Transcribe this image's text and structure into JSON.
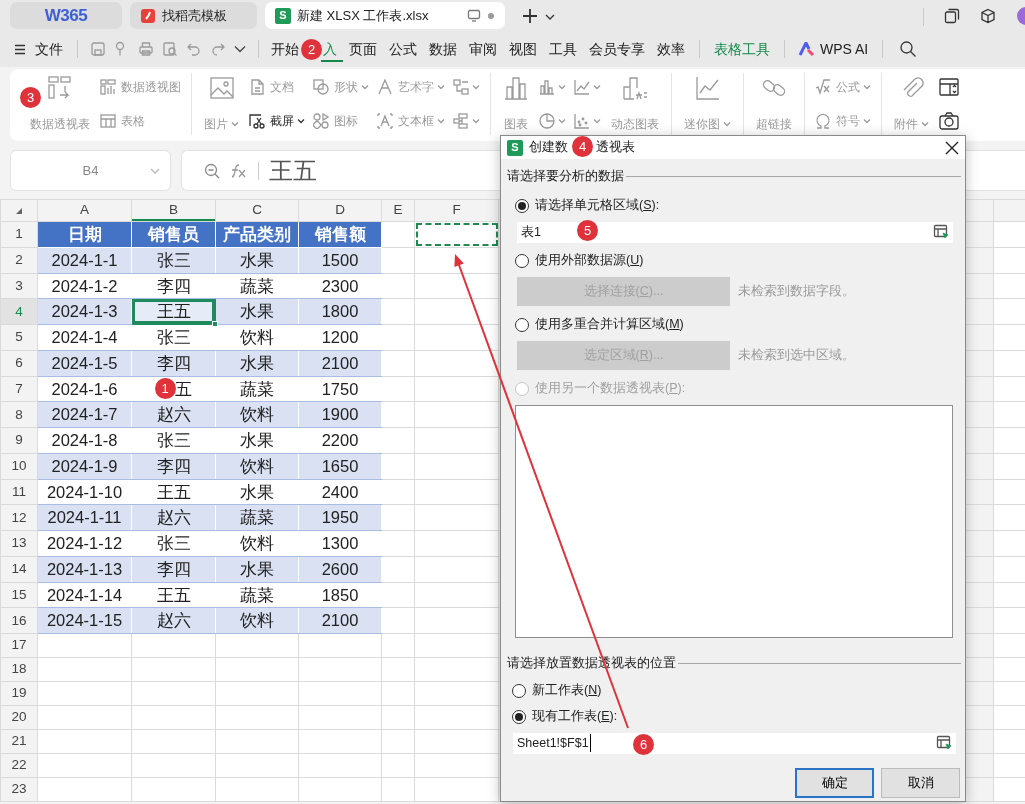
{
  "app_tabs": [
    {
      "kind": "home",
      "label": "W365",
      "selected": false
    },
    {
      "kind": "docer",
      "label": "找稻壳模板",
      "selected": false
    },
    {
      "kind": "sheet",
      "badge": "S",
      "label": "新建 XLSX 工作表.xlsx",
      "selected": true
    }
  ],
  "menu": {
    "file": "文件",
    "tabs": [
      {
        "label": "开始",
        "selected": false
      },
      {
        "label": "入",
        "selected": true,
        "partial": true
      },
      {
        "label": "页面",
        "selected": false
      },
      {
        "label": "公式",
        "selected": false
      },
      {
        "label": "数据",
        "selected": false
      },
      {
        "label": "审阅",
        "selected": false
      },
      {
        "label": "视图",
        "selected": false
      },
      {
        "label": "工具",
        "selected": false
      },
      {
        "label": "会员专享",
        "selected": false
      },
      {
        "label": "效率",
        "selected": false
      }
    ],
    "context_tab": "表格工具",
    "ai": "WPS AI"
  },
  "ribbon": {
    "groups": [
      {
        "columns": [
          {
            "kind": "large",
            "items": [
              {
                "label": "数据透视表",
                "dropdown": false,
                "disabled": true
              }
            ]
          },
          {
            "kind": "stack",
            "items": [
              {
                "label": "数据透视图",
                "dropdown": false,
                "disabled": true
              },
              {
                "label": "表格",
                "dropdown": false,
                "disabled": true
              }
            ]
          }
        ]
      },
      {
        "columns": [
          {
            "kind": "large",
            "items": [
              {
                "label": "图片",
                "dropdown": true,
                "disabled": true
              }
            ]
          },
          {
            "kind": "stack",
            "items": [
              {
                "label": "文档",
                "dropdown": false,
                "disabled": true
              },
              {
                "label": "截屏",
                "dropdown": true,
                "disabled": false
              }
            ]
          },
          {
            "kind": "stack",
            "items": [
              {
                "label": "形状",
                "dropdown": true,
                "disabled": true
              },
              {
                "label": "图标",
                "dropdown": false,
                "disabled": true
              }
            ]
          },
          {
            "kind": "stack",
            "items": [
              {
                "label": "艺术字",
                "dropdown": true,
                "disabled": true
              },
              {
                "label": "文本框",
                "dropdown": true,
                "disabled": true
              }
            ]
          },
          {
            "kind": "stack",
            "items": [
              {
                "dropdown": true,
                "disabled": true
              },
              {
                "dropdown": true,
                "disabled": true
              }
            ]
          }
        ]
      },
      {
        "columns": [
          {
            "kind": "large",
            "items": [
              {
                "label": "图表",
                "dropdown": false,
                "disabled": true
              }
            ]
          },
          {
            "kind": "stack",
            "items": [
              {
                "dropdown": true,
                "disabled": true
              },
              {
                "dropdown": true,
                "disabled": true
              }
            ]
          },
          {
            "kind": "stack",
            "items": [
              {
                "dropdown": true,
                "disabled": true
              },
              {
                "dropdown": true,
                "disabled": true
              }
            ]
          },
          {
            "kind": "large",
            "items": [
              {
                "label": "动态图表",
                "dropdown": false,
                "disabled": true
              }
            ]
          }
        ]
      },
      {
        "columns": [
          {
            "kind": "large",
            "items": [
              {
                "label": "迷你图",
                "dropdown": true,
                "disabled": true
              }
            ]
          }
        ]
      },
      {
        "columns": [
          {
            "kind": "large",
            "items": [
              {
                "label": "超链接",
                "dropdown": false,
                "disabled": true
              }
            ]
          }
        ]
      },
      {
        "columns": [
          {
            "kind": "stack",
            "items": [
              {
                "label": "公式",
                "dropdown": true,
                "disabled": true
              },
              {
                "label": "符号",
                "dropdown": true,
                "disabled": true
              }
            ]
          }
        ]
      },
      {
        "columns": [
          {
            "kind": "large",
            "items": [
              {
                "label": "附件",
                "dropdown": true,
                "disabled": true
              }
            ]
          },
          {
            "kind": "stack",
            "items": [
              {
                "dropdown": false,
                "disabled": false
              },
              {
                "dropdown": false,
                "disabled": false
              }
            ]
          }
        ]
      }
    ]
  },
  "formula_bar": {
    "name_box": "B4",
    "formula": "王五"
  },
  "sheet": {
    "columns": [
      {
        "letter": "A",
        "selected": false
      },
      {
        "letter": "B",
        "selected": true
      },
      {
        "letter": "C",
        "selected": false
      },
      {
        "letter": "D",
        "selected": false
      },
      {
        "letter": "E",
        "selected": false
      },
      {
        "letter": "F",
        "selected": false
      }
    ],
    "row_numbers": [
      {
        "label": "1",
        "selected": false
      },
      {
        "label": "2",
        "selected": false
      },
      {
        "label": "3",
        "selected": false
      },
      {
        "label": "4",
        "selected": true
      },
      {
        "label": "5",
        "selected": false
      },
      {
        "label": "6",
        "selected": false
      },
      {
        "label": "7",
        "selected": false
      },
      {
        "label": "8",
        "selected": false
      },
      {
        "label": "9",
        "selected": false
      },
      {
        "label": "10",
        "selected": false
      },
      {
        "label": "11",
        "selected": false
      },
      {
        "label": "12",
        "selected": false
      },
      {
        "label": "13",
        "selected": false
      },
      {
        "label": "14",
        "selected": false
      },
      {
        "label": "15",
        "selected": false
      },
      {
        "label": "16",
        "selected": false
      },
      {
        "label": "17",
        "selected": false
      },
      {
        "label": "18",
        "selected": false
      },
      {
        "label": "19",
        "selected": false
      },
      {
        "label": "20",
        "selected": false
      },
      {
        "label": "21",
        "selected": false
      },
      {
        "label": "22",
        "selected": false
      },
      {
        "label": "23",
        "selected": false
      }
    ],
    "table_header": [
      "日期",
      "销售员",
      "产品类别",
      "销售额"
    ],
    "rows": [
      [
        {
          "text": "2024-1-1",
          "selected": false
        },
        {
          "text": "张三",
          "selected": false
        },
        {
          "text": "水果",
          "selected": false
        },
        {
          "text": "1500",
          "selected": false
        }
      ],
      [
        {
          "text": "2024-1-2",
          "selected": false
        },
        {
          "text": "李四",
          "selected": false
        },
        {
          "text": "蔬菜",
          "selected": false
        },
        {
          "text": "2300",
          "selected": false
        }
      ],
      [
        {
          "text": "2024-1-3",
          "selected": false
        },
        {
          "text": "王五",
          "selected": true
        },
        {
          "text": "水果",
          "selected": false
        },
        {
          "text": "1800",
          "selected": false
        }
      ],
      [
        {
          "text": "2024-1-4",
          "selected": false
        },
        {
          "text": "张三",
          "selected": false
        },
        {
          "text": "饮料",
          "selected": false
        },
        {
          "text": "1200",
          "selected": false
        }
      ],
      [
        {
          "text": "2024-1-5",
          "selected": false
        },
        {
          "text": "李四",
          "selected": false
        },
        {
          "text": "水果",
          "selected": false
        },
        {
          "text": "2100",
          "selected": false
        }
      ],
      [
        {
          "text": "2024-1-6",
          "selected": false
        },
        {
          "text": "五",
          "selected": false,
          "partial": true
        },
        {
          "text": "蔬菜",
          "selected": false
        },
        {
          "text": "1750",
          "selected": false
        }
      ],
      [
        {
          "text": "2024-1-7",
          "selected": false
        },
        {
          "text": "赵六",
          "selected": false
        },
        {
          "text": "饮料",
          "selected": false
        },
        {
          "text": "1900",
          "selected": false
        }
      ],
      [
        {
          "text": "2024-1-8",
          "selected": false
        },
        {
          "text": "张三",
          "selected": false
        },
        {
          "text": "水果",
          "selected": false
        },
        {
          "text": "2200",
          "selected": false
        }
      ],
      [
        {
          "text": "2024-1-9",
          "selected": false
        },
        {
          "text": "李四",
          "selected": false
        },
        {
          "text": "饮料",
          "selected": false
        },
        {
          "text": "1650",
          "selected": false
        }
      ],
      [
        {
          "text": "2024-1-10",
          "selected": false
        },
        {
          "text": "王五",
          "selected": false
        },
        {
          "text": "水果",
          "selected": false
        },
        {
          "text": "2400",
          "selected": false
        }
      ],
      [
        {
          "text": "2024-1-11",
          "selected": false
        },
        {
          "text": "赵六",
          "selected": false
        },
        {
          "text": "蔬菜",
          "selected": false
        },
        {
          "text": "1950",
          "selected": false
        }
      ],
      [
        {
          "text": "2024-1-12",
          "selected": false
        },
        {
          "text": "张三",
          "selected": false
        },
        {
          "text": "饮料",
          "selected": false
        },
        {
          "text": "1300",
          "selected": false
        }
      ],
      [
        {
          "text": "2024-1-13",
          "selected": false
        },
        {
          "text": "李四",
          "selected": false
        },
        {
          "text": "水果",
          "selected": false
        },
        {
          "text": "2600",
          "selected": false
        }
      ],
      [
        {
          "text": "2024-1-14",
          "selected": false
        },
        {
          "text": "王五",
          "selected": false
        },
        {
          "text": "蔬菜",
          "selected": false
        },
        {
          "text": "1850",
          "selected": false
        }
      ],
      [
        {
          "text": "2024-1-15",
          "selected": false
        },
        {
          "text": "赵六",
          "selected": false
        },
        {
          "text": "饮料",
          "selected": false
        },
        {
          "text": "2100",
          "selected": false
        }
      ]
    ],
    "target_marquee": true
  },
  "dialog": {
    "badge": "S",
    "title_parts": [
      "创建数",
      "透视表"
    ],
    "source_heading": "请选择要分析的数据",
    "source_options": [
      {
        "kind": "range",
        "before": "请选择单元格区域(",
        "key": "S",
        "after": "):",
        "selected": true,
        "disabled": false,
        "value": "表1"
      },
      {
        "kind": "button",
        "before": "使用外部数据源(",
        "key": "U",
        "after": ")",
        "selected": false,
        "disabled": false,
        "button": {
          "before": "选择连接(",
          "key": "C",
          "after": ")...",
          "disabled": true
        },
        "note": "未检索到数据字段。"
      },
      {
        "kind": "button",
        "before": "使用多重合并计算区域(",
        "key": "M",
        "after": ")",
        "selected": false,
        "disabled": false,
        "button": {
          "before": "选定区域(",
          "key": "R",
          "after": ")...",
          "disabled": true
        },
        "note": "未检索到选中区域。"
      },
      {
        "kind": "list",
        "before": "使用另一个数据透视表(",
        "key": "P",
        "after": "):",
        "selected": false,
        "disabled": true
      }
    ],
    "target_heading": "请选择放置数据透视表的位置",
    "target_options": [
      {
        "before": "新工作表(",
        "key": "N",
        "after": ")",
        "selected": false,
        "disabled": false
      },
      {
        "before": "现有工作表(",
        "key": "E",
        "after": "):",
        "selected": true,
        "disabled": false
      }
    ],
    "target_value": "Sheet1!$F$1",
    "buttons": [
      {
        "label": "确定",
        "default": true
      },
      {
        "label": "取消",
        "default": false
      }
    ]
  },
  "annotations": [
    {
      "label": "1"
    },
    {
      "label": "2"
    },
    {
      "label": "3"
    },
    {
      "label": "4"
    },
    {
      "label": "5"
    },
    {
      "label": "6"
    }
  ]
}
